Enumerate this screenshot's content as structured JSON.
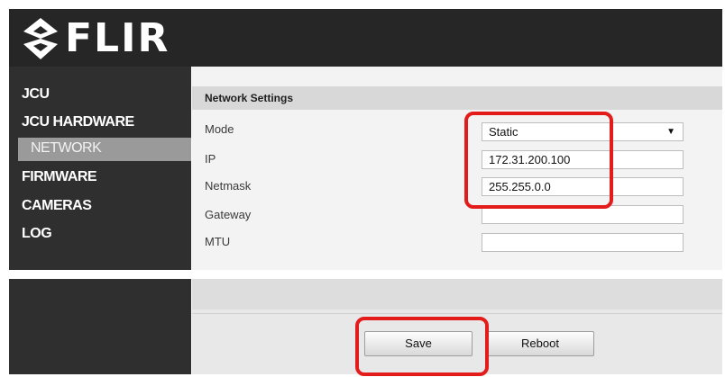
{
  "brand": {
    "logo_text": "FLIR",
    "logo_icon": "flir-diamond-icon"
  },
  "sidebar": {
    "items": [
      {
        "label": "JCU",
        "active": false
      },
      {
        "label": "JCU HARDWARE",
        "active": false
      },
      {
        "label": "NETWORK",
        "active": true
      },
      {
        "label": "FIRMWARE",
        "active": false
      },
      {
        "label": "CAMERAS",
        "active": false
      },
      {
        "label": "LOG",
        "active": false
      }
    ]
  },
  "network": {
    "title": "Network Settings",
    "mode": {
      "label": "Mode",
      "value": "Static"
    },
    "ip": {
      "label": "IP",
      "value": "172.31.200.100"
    },
    "netmask": {
      "label": "Netmask",
      "value": "255.255.0.0"
    },
    "gateway": {
      "label": "Gateway",
      "value": ""
    },
    "mtu": {
      "label": "MTU",
      "value": ""
    }
  },
  "actions": {
    "save_label": "Save",
    "reboot_label": "Reboot"
  },
  "colors": {
    "highlight": "#e31b1b",
    "header_bg": "#262626",
    "sidebar_bg": "#2f2f2f",
    "active_nav_bg": "#9a9a9a"
  }
}
